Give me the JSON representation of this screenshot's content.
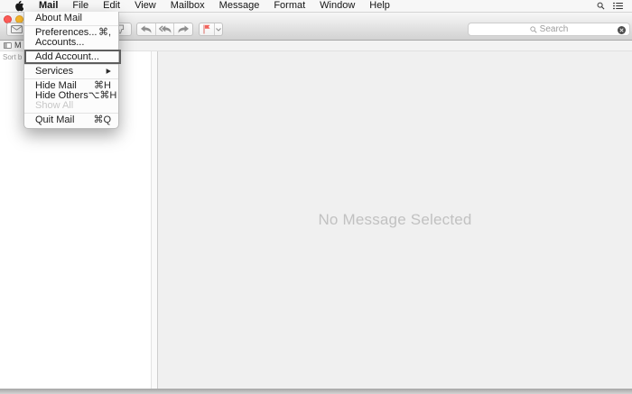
{
  "menubar": {
    "items": [
      "Mail",
      "File",
      "Edit",
      "View",
      "Mailbox",
      "Message",
      "Format",
      "Window",
      "Help"
    ]
  },
  "mail_menu": {
    "about": "About Mail",
    "preferences": "Preferences...",
    "preferences_shortcut": "⌘,",
    "accounts": "Accounts...",
    "add_account": "Add Account...",
    "services": "Services",
    "hide_mail": "Hide Mail",
    "hide_mail_shortcut": "⌘H",
    "hide_others": "Hide Others",
    "hide_others_shortcut": "⌥⌘H",
    "show_all": "Show All",
    "quit": "Quit Mail",
    "quit_shortcut": "⌘Q"
  },
  "toolbar": {
    "search_placeholder": "Search"
  },
  "favorites_bar": {
    "mailboxes_label": "M"
  },
  "message_list": {
    "sort_label": "Sort b"
  },
  "content": {
    "empty_message": "No Message Selected"
  },
  "icons": {
    "submenu_arrow": "▶",
    "names": [
      "apple-logo",
      "spotlight-search-icon",
      "notification-center-icon",
      "envelope-icon",
      "thumbs-down-icon",
      "reply-icon",
      "reply-all-icon",
      "forward-icon",
      "flag-icon",
      "chevron-down-icon",
      "search-icon",
      "clear-circle-icon",
      "mailboxes-sidebar-icon"
    ]
  },
  "colors": {
    "flag_red": "#f2635c",
    "traffic_red": "#fc5b57",
    "traffic_yellow": "#fdbc2e",
    "annotation_box": "#5e5e5e",
    "empty_text": "#c1c1c1"
  }
}
